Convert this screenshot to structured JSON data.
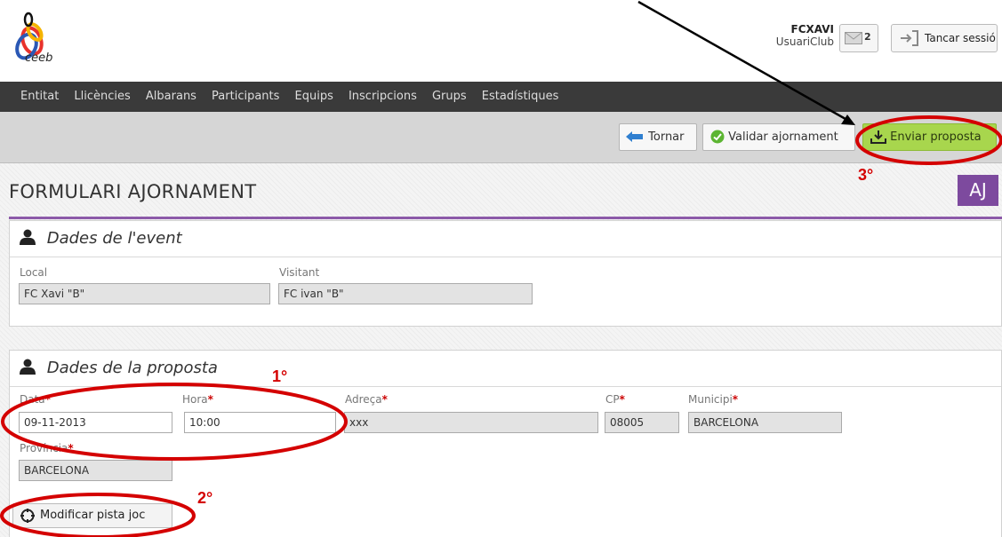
{
  "header": {
    "logo_text": "ceeb",
    "username": "FCXAVI",
    "role": "UsuariClub",
    "mail_count": "2",
    "logout_label": "Tancar sessió"
  },
  "nav": [
    "Entitat",
    "Llicències",
    "Albarans",
    "Participants",
    "Equips",
    "Inscripcions",
    "Grups",
    "Estadístiques"
  ],
  "toolbar": {
    "back_label": "Tornar",
    "validate_label": "Validar ajornament",
    "send_label": "Enviar proposta"
  },
  "page": {
    "title": "FORMULARI AJORNAMENT",
    "badge": "AJ"
  },
  "event": {
    "heading": "Dades de l'event",
    "local_label": "Local",
    "local_value": "FC Xavi \"B\"",
    "visitor_label": "Visitant",
    "visitor_value": "FC ivan \"B\""
  },
  "proposal": {
    "heading": "Dades de la proposta",
    "date_label": "Data",
    "date_value": "09-11-2013",
    "hour_label": "Hora",
    "hour_value": "10:00",
    "address_label": "Adreça",
    "address_value": "xxx",
    "cp_label": "CP",
    "cp_value": "08005",
    "municipality_label": "Municipi",
    "municipality_value": "BARCELONA",
    "province_label": "Província",
    "province_value": "BARCELONA",
    "required_mark": "*"
  },
  "modify_button_label": "Modificar pista joc",
  "annotations": {
    "step1": "1°",
    "step2": "2°",
    "step3": "3°",
    "color": "#d40000"
  },
  "colors": {
    "nav_bg": "#3a3a3a",
    "toolbar_bg": "#d6d6d6",
    "send_button": "#a8d64d",
    "badge": "#7d4a9e",
    "accent_rule": "#8c5aa9"
  }
}
